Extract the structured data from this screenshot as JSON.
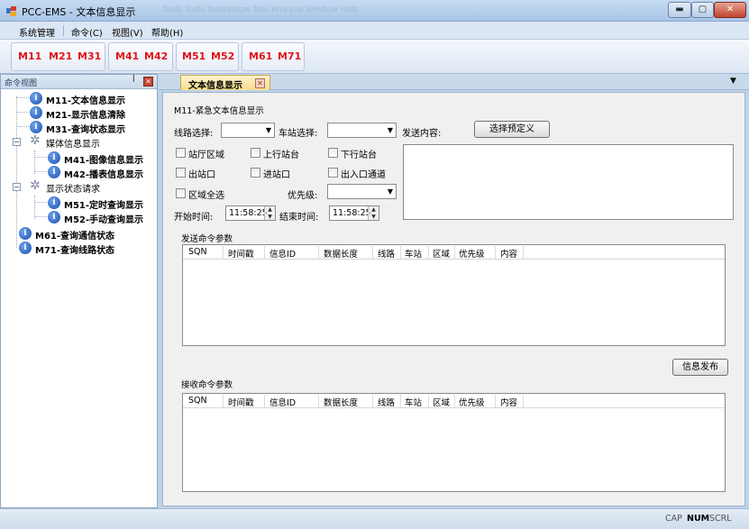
{
  "window": {
    "title": "PCC-EMS - 文本信息显示",
    "ghost_menu": "Tools   Tools   NoWindow   Tool   Analyze   Window   Help",
    "min_label": "▬",
    "max_label": "▢",
    "close_label": "✕"
  },
  "menubar": {
    "items": [
      {
        "label": "系统管理"
      },
      {
        "label": "命令(C)"
      },
      {
        "label": "视图(V)"
      },
      {
        "label": "帮助(H)"
      }
    ]
  },
  "toolbar": {
    "group1": [
      "M11",
      "M21",
      "M31"
    ],
    "group2": [
      "M41",
      "M42"
    ],
    "group3": [
      "M51",
      "M52"
    ],
    "group4": [
      "M61",
      "M71"
    ],
    "accent_color": "#e0161b"
  },
  "left_panel": {
    "title": "命令视图",
    "pin": "ꟾ",
    "close": "✕",
    "items": [
      {
        "label": "M11-文本信息显示",
        "icon": "info-icon",
        "level": 1
      },
      {
        "label": "M21-显示信息清除",
        "icon": "info-icon",
        "level": 1
      },
      {
        "label": "M31-查询状态显示",
        "icon": "info-icon",
        "level": 1
      },
      {
        "label": "媒体信息显示",
        "icon": "gear-icon",
        "level": 1
      },
      {
        "label": "M41-图像信息显示",
        "icon": "info-icon",
        "level": 2
      },
      {
        "label": "M42-播表信息显示",
        "icon": "info-icon",
        "level": 2
      },
      {
        "label": "显示状态请求",
        "icon": "gear-icon",
        "level": 1
      },
      {
        "label": "M51-定时查询显示",
        "icon": "info-icon",
        "level": 2
      },
      {
        "label": "M52-手动查询显示",
        "icon": "info-icon",
        "level": 2
      },
      {
        "label": "M61-查询通信状态",
        "icon": "info-icon",
        "level": 0
      },
      {
        "label": "M71-查询线路状态",
        "icon": "info-icon",
        "level": 0
      }
    ],
    "toggle_minus": "−",
    "info_glyph": "i",
    "gear_glyph": "✲"
  },
  "tab": {
    "label": "文本信息显示",
    "close": "✕",
    "dropdown": "▼"
  },
  "form": {
    "section_title": "M11-紧急文本信息显示",
    "line_label": "线路选择:",
    "station_label": "车站选择:",
    "send_content_label": "发送内容:",
    "preset_button": "选择预定义",
    "combo_arrow": "▼",
    "checkboxes": [
      {
        "label": "站厅区域"
      },
      {
        "label": "上行站台"
      },
      {
        "label": "下行站台"
      },
      {
        "label": "出站口"
      },
      {
        "label": "进站口"
      },
      {
        "label": "出入口通道"
      },
      {
        "label": "区域全选"
      }
    ],
    "priority_label": "优先级:",
    "start_label": "开始时间:",
    "start_value": "11:58:25",
    "end_label": "结束时间:",
    "end_value": "11:58:25",
    "spin_up": "▲",
    "spin_down": "▼"
  },
  "send_params": {
    "title": "发送命令参数",
    "columns": [
      "SQN",
      "时间戳",
      "信息ID",
      "数据长度",
      "线路",
      "车站",
      "区域",
      "优先级",
      "内容"
    ]
  },
  "publish_button": "信息发布",
  "recv_params": {
    "title": "接收命令参数",
    "columns": [
      "SQN",
      "时间戳",
      "信息ID",
      "数据长度",
      "线路",
      "车站",
      "区域",
      "优先级",
      "内容"
    ]
  },
  "statusbar": {
    "cap": "CAP",
    "num": "NUM",
    "scrl": "SCRL"
  }
}
